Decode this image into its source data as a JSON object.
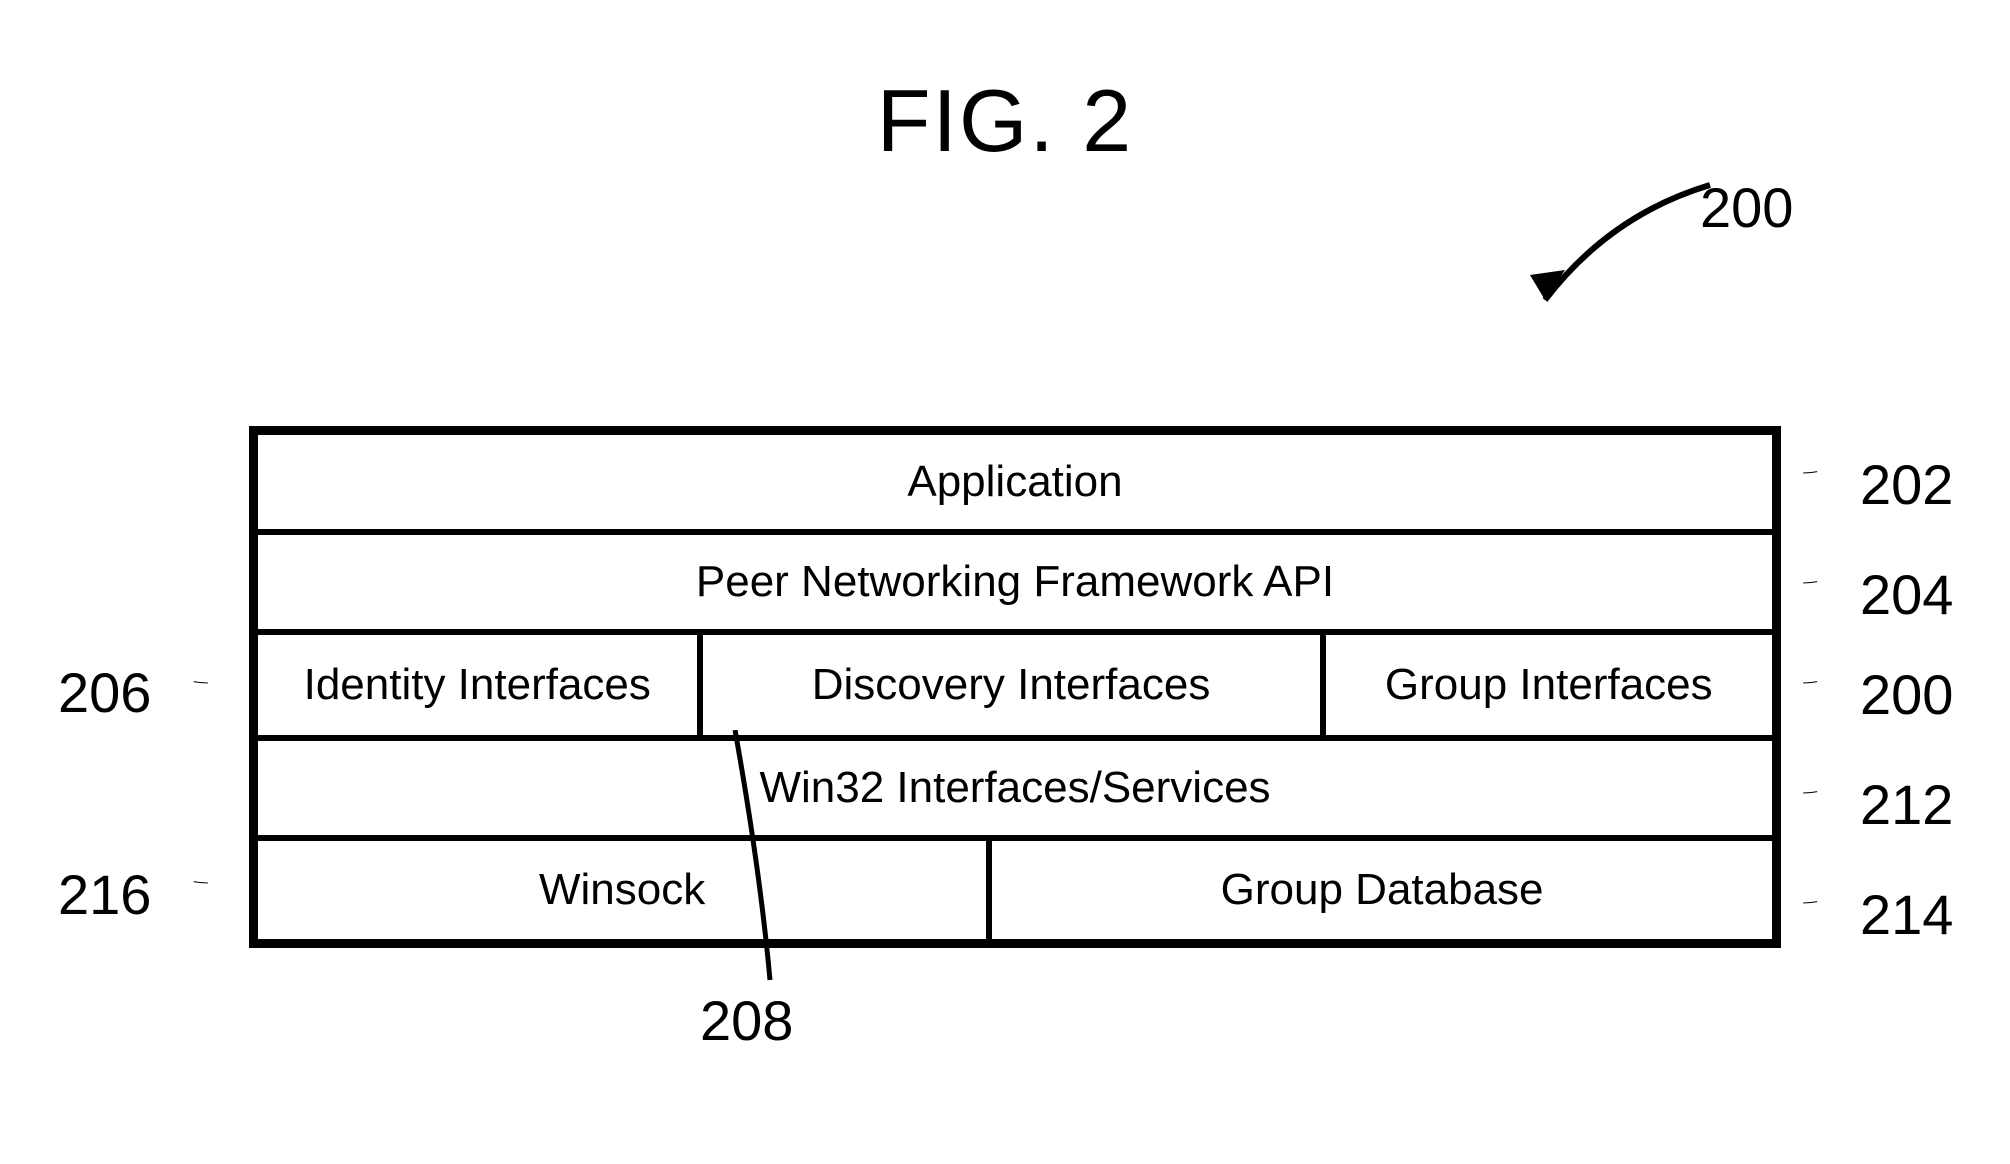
{
  "title": "FIG. 2",
  "main_ref": "200",
  "rows": {
    "r1": "Application",
    "r2": "Peer Networking Framework API",
    "r3a": "Identity Interfaces",
    "r3b": "Discovery Interfaces",
    "r3c": "Group Interfaces",
    "r4": "Win32 Interfaces/Services",
    "r5a": "Winsock",
    "r5b": "Group Database"
  },
  "refs": {
    "l206": "206",
    "l216": "216",
    "l208": "208",
    "r202": "202",
    "r204": "204",
    "r200b": "200",
    "r212": "212",
    "r214": "214"
  }
}
